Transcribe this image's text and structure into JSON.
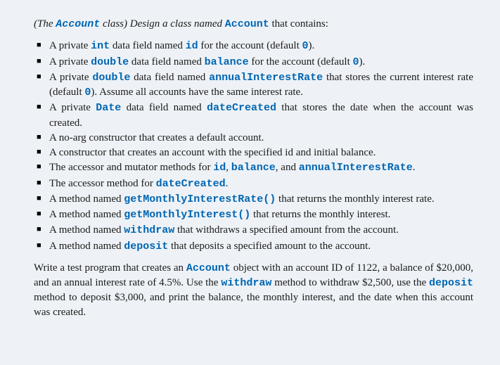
{
  "intro": {
    "p1": "(The ",
    "p2": "Account",
    "p3": " class) Design a class named ",
    "p4": "Account",
    "p5": " that contains:"
  },
  "items": [
    {
      "t": [
        {
          "s": "A private "
        },
        {
          "s": "int",
          "c": 1
        },
        {
          "s": " data field named "
        },
        {
          "s": "id",
          "c": 1
        },
        {
          "s": " for the account (default "
        },
        {
          "s": "0",
          "c": 1
        },
        {
          "s": ")."
        }
      ]
    },
    {
      "t": [
        {
          "s": "A private "
        },
        {
          "s": "double",
          "c": 1
        },
        {
          "s": " data field named "
        },
        {
          "s": "balance",
          "c": 1
        },
        {
          "s": " for the account (default "
        },
        {
          "s": "0",
          "c": 1
        },
        {
          "s": ")."
        }
      ]
    },
    {
      "t": [
        {
          "s": "A private "
        },
        {
          "s": "double",
          "c": 1
        },
        {
          "s": " data field named "
        },
        {
          "s": "annualInterestRate",
          "c": 1
        },
        {
          "s": " that stores the current interest rate (default "
        },
        {
          "s": "0",
          "c": 1
        },
        {
          "s": "). Assume all accounts have the same interest rate."
        }
      ]
    },
    {
      "t": [
        {
          "s": "A private "
        },
        {
          "s": "Date",
          "c": 1
        },
        {
          "s": " data field named "
        },
        {
          "s": "dateCreated",
          "c": 1
        },
        {
          "s": " that stores the date when the account was created."
        }
      ]
    },
    {
      "t": [
        {
          "s": "A no-arg constructor that creates a default account."
        }
      ]
    },
    {
      "t": [
        {
          "s": "A constructor that creates an account with the specified id and initial balance."
        }
      ]
    },
    {
      "t": [
        {
          "s": "The accessor and mutator methods for "
        },
        {
          "s": "id",
          "c": 1
        },
        {
          "s": ", "
        },
        {
          "s": "balance",
          "c": 1
        },
        {
          "s": ", and "
        },
        {
          "s": "annualInterestRate",
          "c": 1
        },
        {
          "s": "."
        }
      ]
    },
    {
      "t": [
        {
          "s": "The accessor method for "
        },
        {
          "s": "dateCreated",
          "c": 1
        },
        {
          "s": "."
        }
      ]
    },
    {
      "t": [
        {
          "s": "A method named "
        },
        {
          "s": "getMonthlyInterestRate()",
          "c": 1
        },
        {
          "s": " that returns the monthly interest rate."
        }
      ]
    },
    {
      "t": [
        {
          "s": "A method named "
        },
        {
          "s": "getMonthlyInterest()",
          "c": 1
        },
        {
          "s": " that returns the monthly interest."
        }
      ]
    },
    {
      "t": [
        {
          "s": "A method named "
        },
        {
          "s": "withdraw",
          "c": 1
        },
        {
          "s": " that withdraws a specified amount from the account."
        }
      ]
    },
    {
      "t": [
        {
          "s": "A method named "
        },
        {
          "s": "deposit",
          "c": 1
        },
        {
          "s": " that deposits a specified amount to the account."
        }
      ]
    }
  ],
  "footer": [
    {
      "s": "Write a test program that creates an "
    },
    {
      "s": "Account",
      "c": 1
    },
    {
      "s": " object with an account ID of 1122, a balance of $20,000, and an annual interest rate of 4.5%. Use the "
    },
    {
      "s": "withdraw",
      "c": 1
    },
    {
      "s": " method to withdraw $2,500, use the "
    },
    {
      "s": "deposit",
      "c": 1
    },
    {
      "s": " method to deposit $3,000, and print the balance, the monthly interest, and the date when this account was created."
    }
  ]
}
